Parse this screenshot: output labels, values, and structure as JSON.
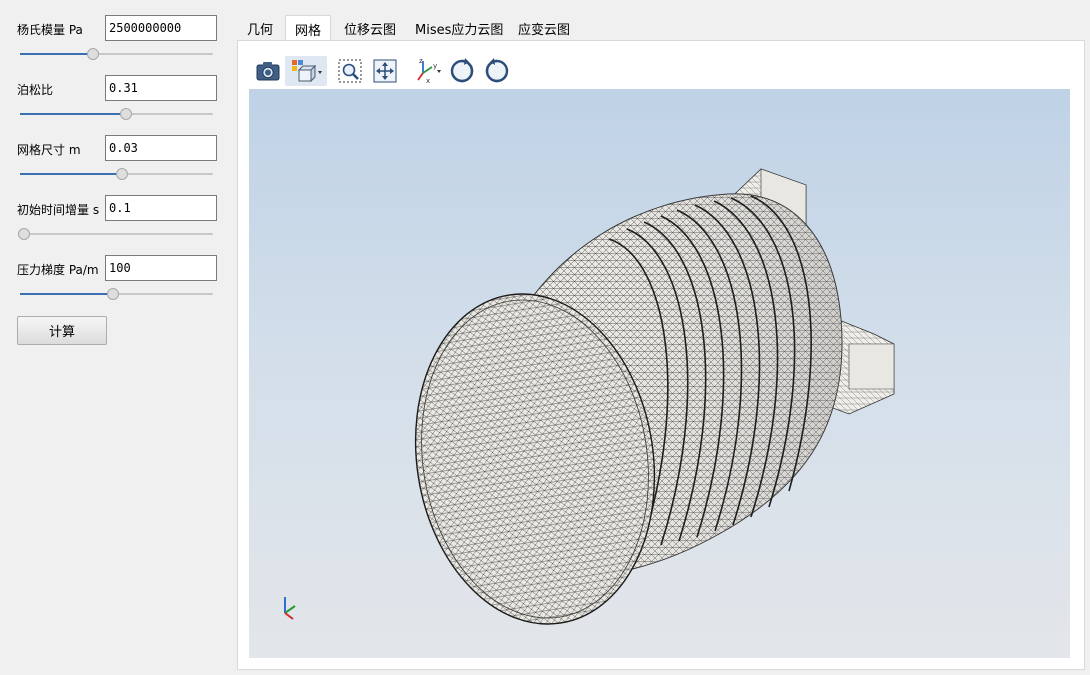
{
  "params": [
    {
      "label": "杨氏模量 Pa",
      "value": "2500000000",
      "slider_fraction": 0.38
    },
    {
      "label": "泊松比",
      "value": "0.31",
      "slider_fraction": 0.55
    },
    {
      "label": "网格尺寸 m",
      "value": "0.03",
      "slider_fraction": 0.53
    },
    {
      "label": "初始时间增量 s",
      "value": "0.1",
      "slider_fraction": 0.0
    },
    {
      "label": "压力梯度 Pa/m",
      "value": "100",
      "slider_fraction": 0.48
    }
  ],
  "calc_button": "计算",
  "tabs": [
    {
      "label": "几何",
      "active": false
    },
    {
      "label": "网格",
      "active": true
    },
    {
      "label": "位移云图",
      "active": false
    },
    {
      "label": "Mises应力云图",
      "active": false
    },
    {
      "label": "应变云图",
      "active": false
    }
  ],
  "toolbar": [
    "camera-icon",
    "display-mode-icon",
    "zoom-box-icon",
    "fit-all-icon",
    "view-axes-icon",
    "rotate-cw-icon",
    "rotate-ccw-icon"
  ],
  "colors": {
    "accent": "#3a6fb0",
    "mesh": "#2a2a2a",
    "model": "#e9e7e1"
  }
}
